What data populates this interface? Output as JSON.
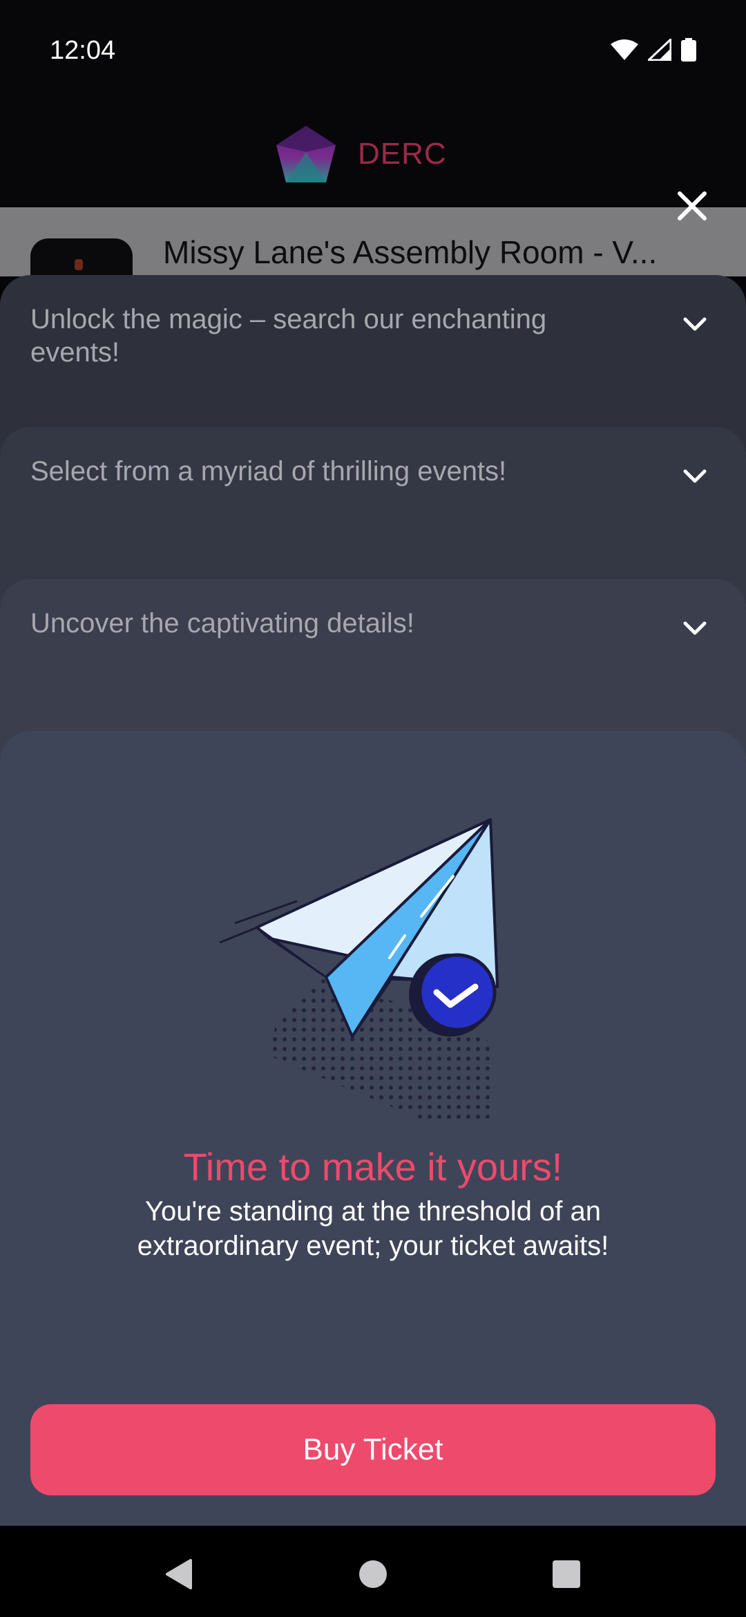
{
  "status_bar": {
    "time": "12:04"
  },
  "header": {
    "brand_name": "DERC"
  },
  "background": {
    "event_title": "Missy Lane's Assembly Room - V..."
  },
  "steps": [
    {
      "label": "Unlock the magic – search our enchanting events!"
    },
    {
      "label": "Select from a myriad of thrilling events!"
    },
    {
      "label": "Uncover the captivating details!"
    }
  ],
  "main": {
    "headline": "Time to make it yours!",
    "subtext": "You're standing at the threshold of an extraordinary event; your ticket awaits!",
    "buy_label": "Buy Ticket"
  },
  "colors": {
    "accent": "#ee4a6c",
    "brand_text": "#9b2a48",
    "panel": "#3f4558"
  }
}
